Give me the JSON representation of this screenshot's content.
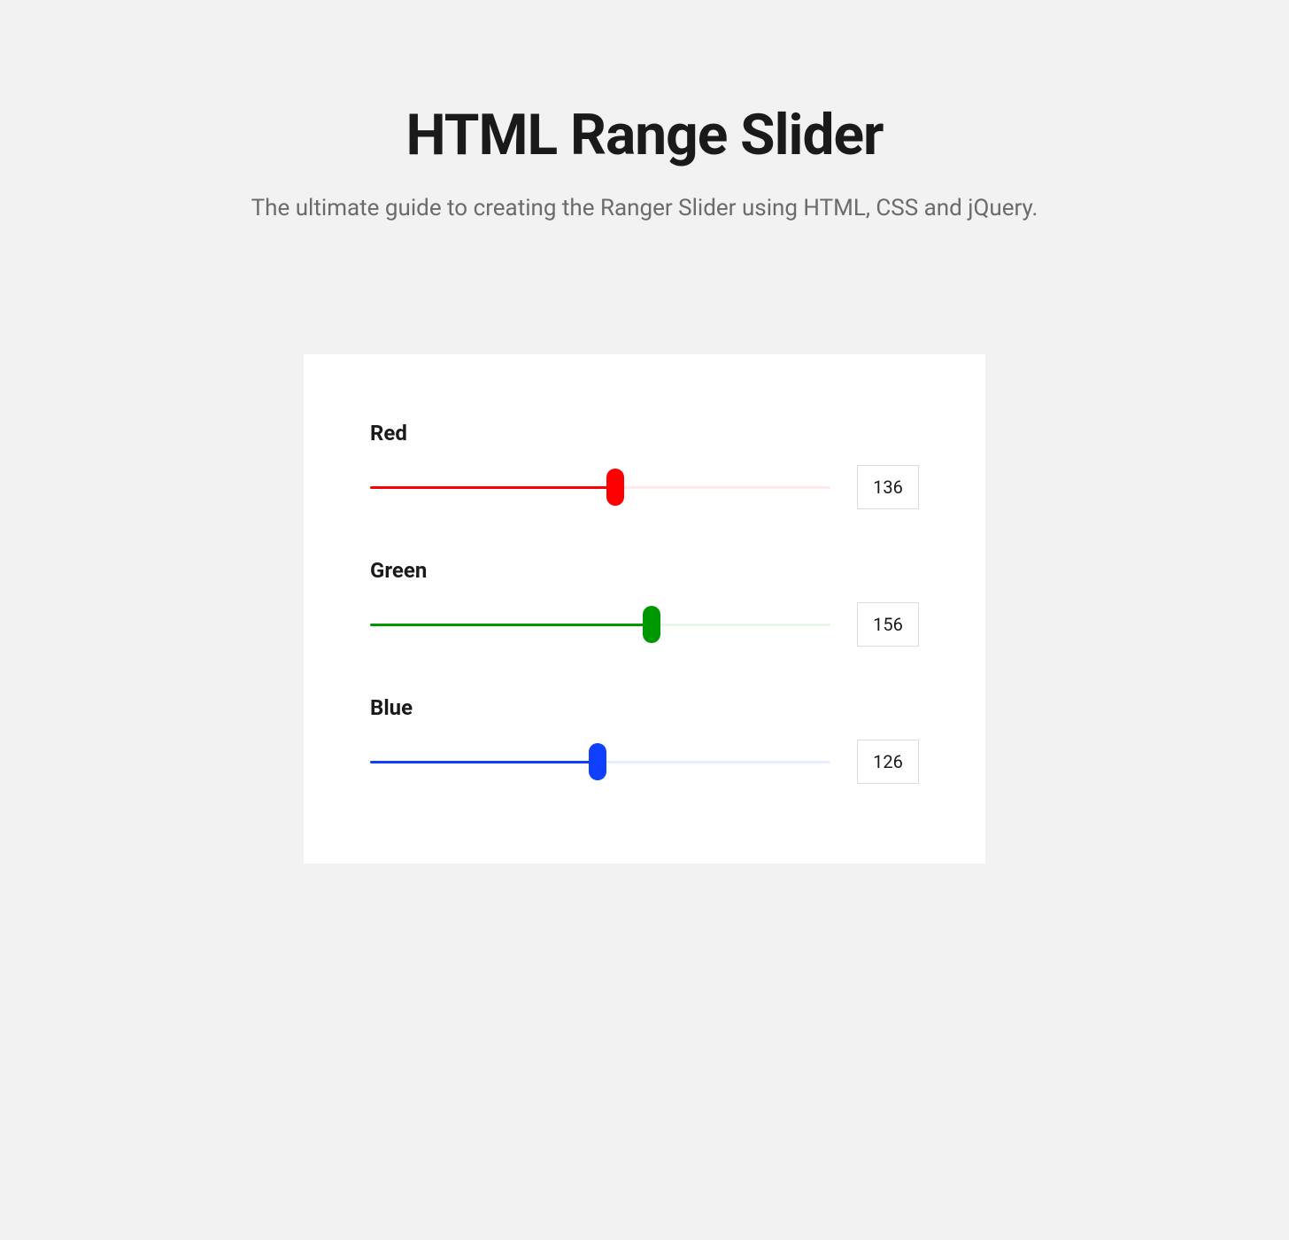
{
  "header": {
    "title": "HTML Range Slider",
    "subtitle": "The ultimate guide to creating the Ranger Slider using HTML, CSS and jQuery."
  },
  "sliders": {
    "max": 255,
    "red": {
      "label": "Red",
      "value": "136",
      "percent": 53.3
    },
    "green": {
      "label": "Green",
      "value": "156",
      "percent": 61.2
    },
    "blue": {
      "label": "Blue",
      "value": "126",
      "percent": 49.4
    }
  }
}
